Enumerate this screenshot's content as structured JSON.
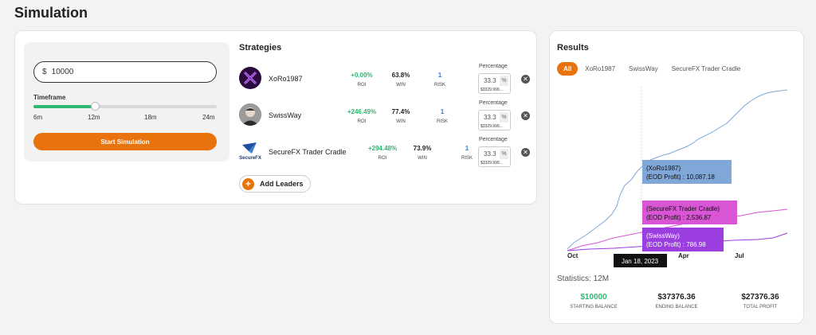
{
  "page": {
    "title": "Simulation"
  },
  "form": {
    "currency": "$",
    "amount": "10000",
    "timeframe_label": "Timeframe",
    "timeframe_options": [
      "6m",
      "12m",
      "18m",
      "24m"
    ],
    "timeframe_selected_fraction": 0.333,
    "start_label": "Start Simulation"
  },
  "strategies": {
    "title": "Strategies",
    "percentage_label": "Percentage",
    "unit": "%",
    "items": [
      {
        "name": "XoRo1987",
        "roi": "+0.00%",
        "roi_label": "ROI",
        "win": "63.8%",
        "win_label": "WIN",
        "risk": "1",
        "risk_label": "RISK",
        "pct": "33.3",
        "pct_sub": "$3329.999..."
      },
      {
        "name": "SwissWay",
        "roi": "+246.49%",
        "roi_label": "ROI",
        "win": "77.4%",
        "win_label": "WIN",
        "risk": "1",
        "risk_label": "RISK",
        "pct": "33.3",
        "pct_sub": "$3329.999..."
      },
      {
        "name": "SecureFX Trader Cradle",
        "logo_text": "SecureFX",
        "roi": "+294.48%",
        "roi_label": "ROI",
        "win": "73.9%",
        "win_label": "WIN",
        "risk": "1",
        "risk_label": "RISK",
        "pct": "33.3",
        "pct_sub": "$3329.999..."
      }
    ],
    "add_label": "Add Leaders"
  },
  "results": {
    "title": "Results",
    "tabs": [
      "All",
      "XoRo1987",
      "SwissWay",
      "SecureFX Trader Cradle"
    ],
    "active_tab": "All",
    "chart": {
      "x_labels": [
        "Oct",
        "Apr",
        "Jul"
      ],
      "hover_date": "Jan 18, 2023",
      "tooltips": [
        {
          "series": "(XoRo1987)",
          "profit": "(EOD Profit) : 10,087.18",
          "color": "#7fa7d8"
        },
        {
          "series": "(SecureFX Trader Cradle)",
          "profit": "(EOD Profit) : 2,536.87",
          "color": "#d955d5"
        },
        {
          "series": "(SwissWay)",
          "profit": "(EOD Profit) : 786.98",
          "color": "#9a3ee0"
        }
      ]
    },
    "statistics": {
      "label": "Statistics:",
      "period": "12M",
      "items": [
        {
          "value": "$10000",
          "label": "STARTING BALANCE"
        },
        {
          "value": "$37376.36",
          "label": "ENDING BALANCE"
        },
        {
          "value": "$27376.36",
          "label": "TOTAL PROFIT"
        }
      ]
    }
  },
  "colors": {
    "accent": "#e8720c",
    "positive": "#2eb872",
    "risk": "#3a82d4",
    "xoro": "#7fa7d8",
    "secure": "#d955d5",
    "swiss": "#9a3ee0"
  }
}
